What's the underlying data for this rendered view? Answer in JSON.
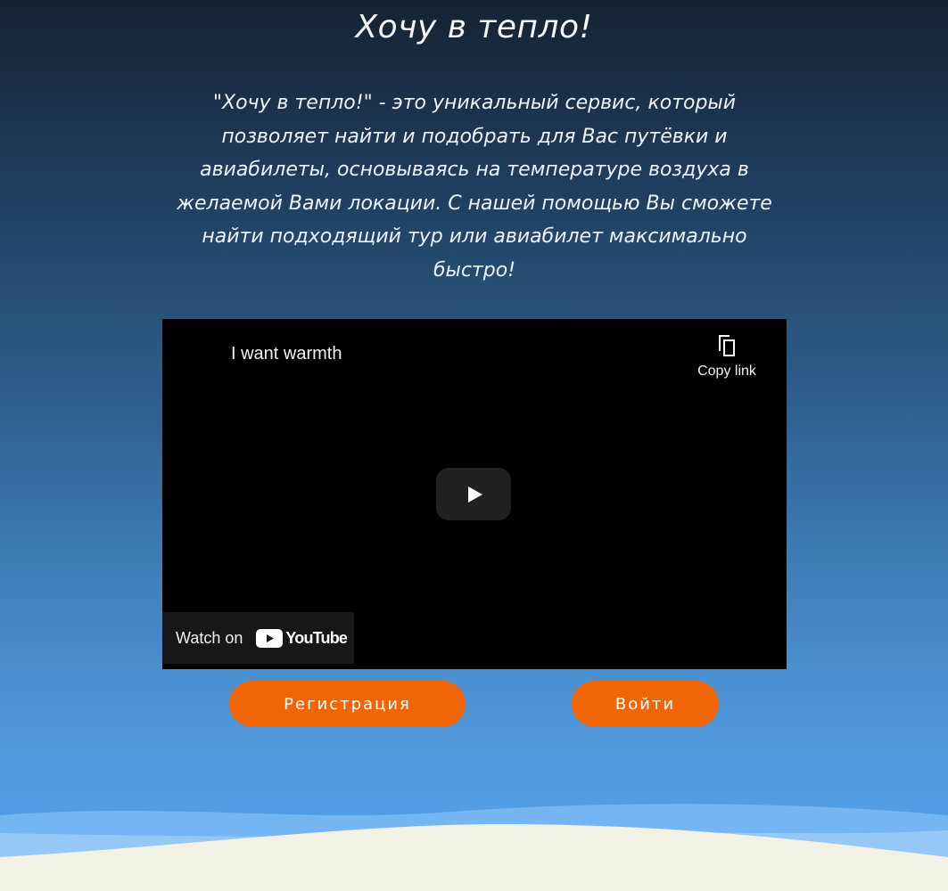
{
  "header": {
    "title": "Хочу в тепло!",
    "description": "\"Хочу в тепло!\" - это уникальный сервис, который позволяет найти и подобрать для Вас путёвки и авиабилеты, основываясь на температуре воздуха в желаемой Вами локации. С нашей помощью Вы сможете найти подходящий тур или авиабилет максимально быстро!"
  },
  "video": {
    "title": "I want warmth",
    "copy_link_label": "Copy link",
    "watch_on_label": "Watch on",
    "youtube_logo_text": "YouTube",
    "icons": {
      "copy": "copy-icon",
      "play": "play-icon",
      "logo": "youtube-logo-icon"
    }
  },
  "actions": {
    "register_label": "Регистрация",
    "login_label": "Войти"
  },
  "colors": {
    "accent": "#f06606",
    "youtube_red": "#ff0000",
    "footer_sand": "#f2f1e6",
    "wave_light": "#85c0f8"
  }
}
